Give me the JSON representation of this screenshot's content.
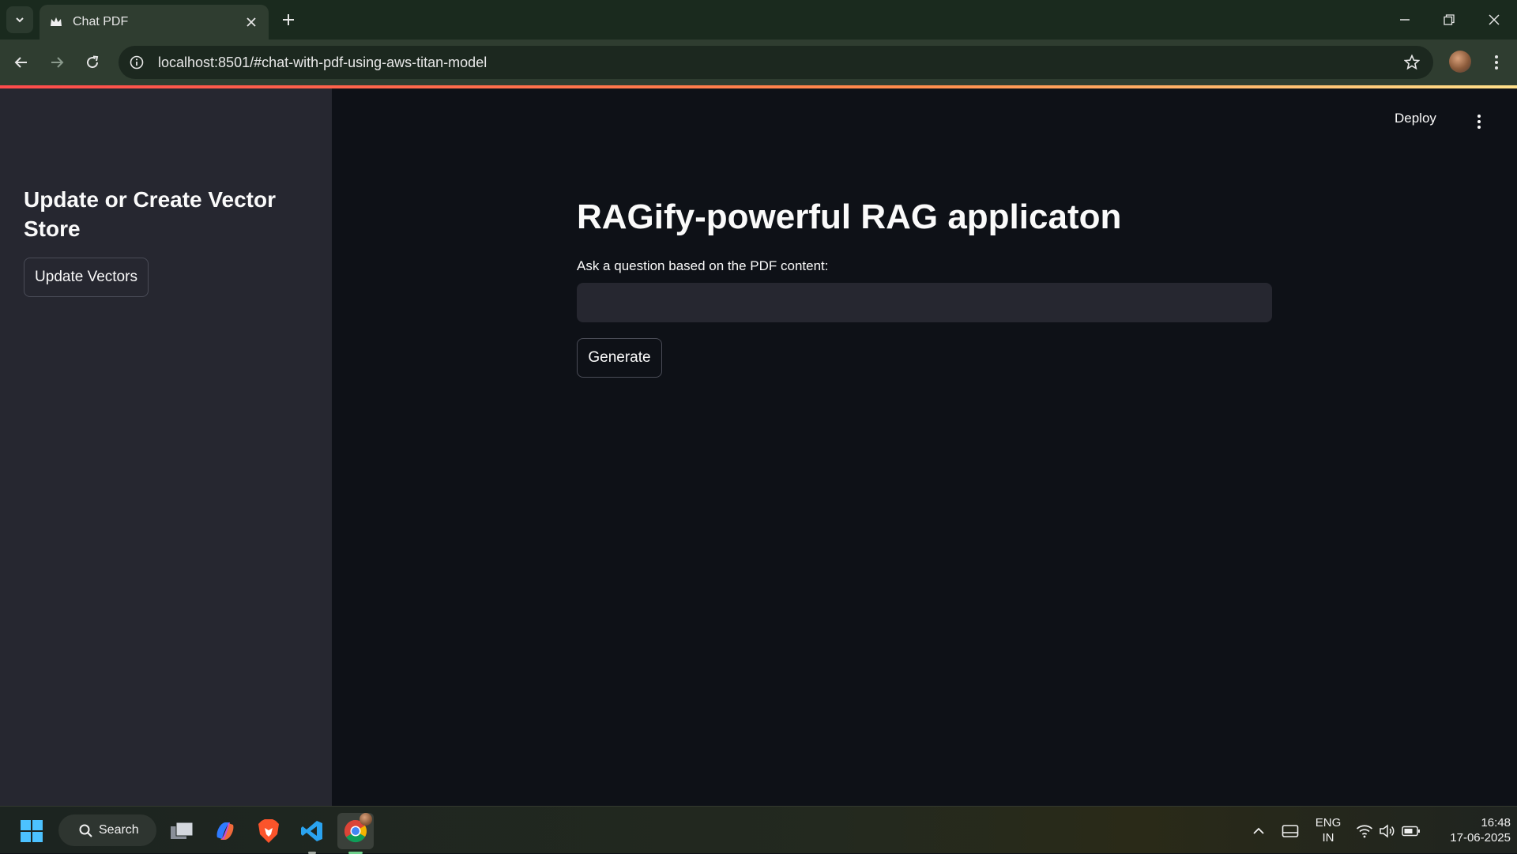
{
  "browser": {
    "tab_title": "Chat PDF",
    "url": "localhost:8501/#chat-with-pdf-using-aws-titan-model"
  },
  "app": {
    "header": {
      "deploy_label": "Deploy"
    },
    "sidebar": {
      "title": "Update or Create Vector Store",
      "update_button_label": "Update Vectors"
    },
    "main": {
      "title": "RAGify-powerful RAG applicaton",
      "question_label": "Ask a question based on the PDF content:",
      "question_value": "",
      "generate_button_label": "Generate"
    }
  },
  "taskbar": {
    "search_label": "Search",
    "language_line1": "ENG",
    "language_line2": "IN",
    "time": "16:48",
    "date": "17-06-2025"
  },
  "colors": {
    "accent": "#ff4b4b",
    "background": "#0e1117",
    "sidebar": "#262730"
  }
}
